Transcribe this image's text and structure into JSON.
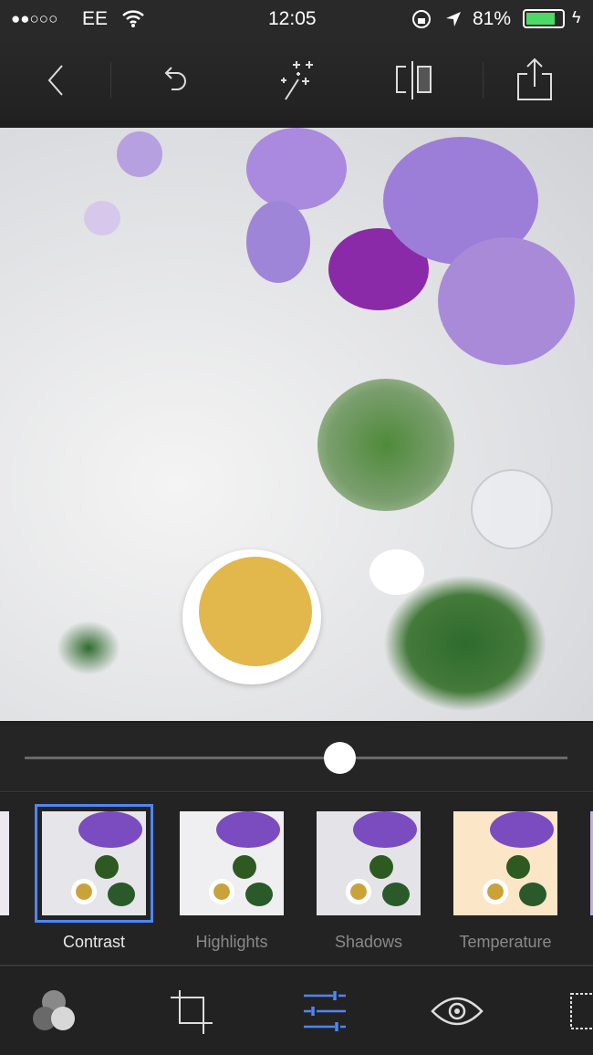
{
  "status_bar": {
    "signal": "●●○○○",
    "carrier": "EE",
    "time": "12:05",
    "battery": "81%",
    "battery_level": 0.81,
    "battery_color": "#4cd964"
  },
  "toolbar": {
    "icons": [
      "back-icon",
      "undo-icon",
      "auto-enhance-icon",
      "before-after-icon",
      "share-icon"
    ]
  },
  "slider": {
    "value": 0.58
  },
  "adjustments": [
    {
      "label": "Contrast",
      "selected": true
    },
    {
      "label": "Highlights",
      "selected": false
    },
    {
      "label": "Shadows",
      "selected": false
    },
    {
      "label": "Temperature",
      "selected": false
    }
  ],
  "bottom_bar": {
    "icons": [
      "looks-icon",
      "crop-icon",
      "adjust-icon",
      "eye-icon",
      "vignette-icon"
    ],
    "active": "adjust-icon",
    "accent": "#4f86f7"
  }
}
